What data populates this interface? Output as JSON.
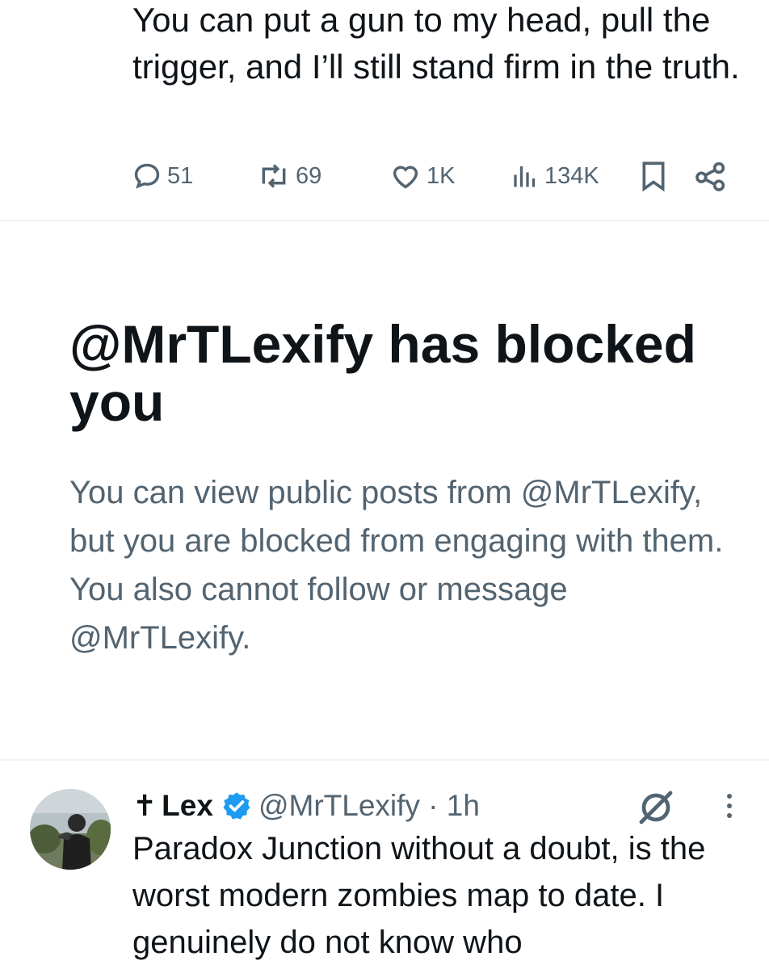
{
  "tweet": {
    "text": "You can put a gun to my head, pull the trigger, and I’ll still stand firm in the truth.",
    "replies": "51",
    "reposts": "69",
    "likes": "1K",
    "views": "134K"
  },
  "blocked": {
    "title": "@MrTLexify has blocked you",
    "description": "You can view public posts from @MrTLexify, but you are blocked from engaging with them. You also cannot follow or message @MrTLexify."
  },
  "reply": {
    "cross": "✝",
    "name": "Lex",
    "handle": "@MrTLexify · 1h",
    "text": "Paradox Junction without a doubt, is the worst modern zombies map to date. I genuinely do not know who"
  },
  "colors": {
    "text": "#0f1419",
    "secondary": "#536471",
    "divider": "#eff3f4",
    "verified": "#1d9bf0"
  },
  "icons": [
    "reply-icon",
    "repost-icon",
    "like-icon",
    "views-icon",
    "bookmark-icon",
    "share-icon",
    "verified-badge-icon",
    "grok-icon",
    "more-icon"
  ]
}
